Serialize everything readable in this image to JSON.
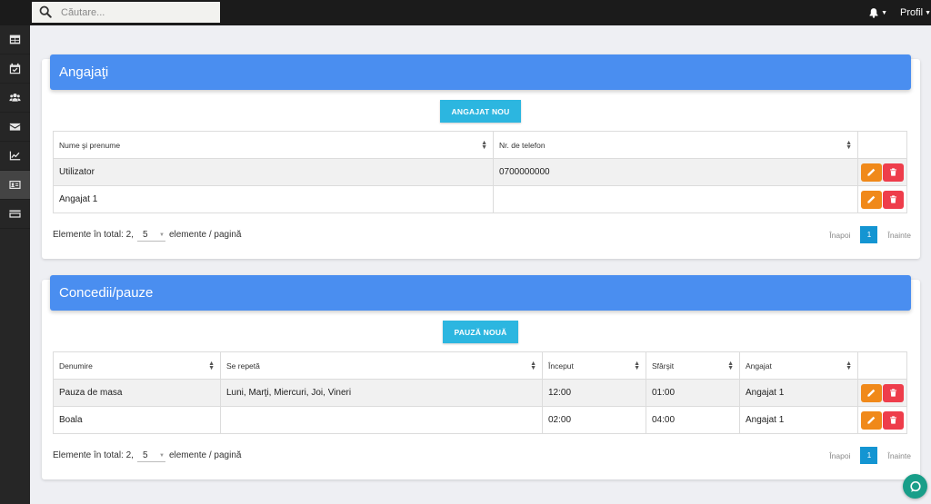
{
  "search": {
    "placeholder": "Căutare..."
  },
  "header": {
    "profile_label": "Profil"
  },
  "employees": {
    "title": "Angajaţi",
    "new_button": "Angajat nou",
    "columns": [
      "Nume şi prenume",
      "Nr. de telefon"
    ],
    "rows": [
      {
        "name": "Utilizator",
        "phone": "0700000000"
      },
      {
        "name": "Angajat 1",
        "phone": ""
      }
    ],
    "footer": {
      "total_label": "Elemente în total: 2,",
      "per_page": "5",
      "per_page_suffix": "elemente / pagină"
    },
    "pager": {
      "prev": "Înapoi",
      "page": "1",
      "next": "Înainte"
    }
  },
  "leaves": {
    "title": "Concedii/pauze",
    "new_button": "Pauză nouă",
    "columns": [
      "Denumire",
      "Se repetă",
      "Început",
      "Sfârşit",
      "Angajat"
    ],
    "rows": [
      {
        "name": "Pauza de masa",
        "repeat": "Luni, Marţi, Miercuri, Joi, Vineri",
        "start": "12:00",
        "end": "01:00",
        "employee": "Angajat 1"
      },
      {
        "name": "Boala",
        "repeat": "",
        "start": "02:00",
        "end": "04:00",
        "employee": "Angajat 1"
      }
    ],
    "footer": {
      "total_label": "Elemente în total: 2,",
      "per_page": "5",
      "per_page_suffix": "elemente / pagină"
    },
    "pager": {
      "prev": "Înapoi",
      "page": "1",
      "next": "Înainte"
    }
  },
  "icons": {
    "sidebar": [
      "table-icon",
      "calendar-check-icon",
      "users-icon",
      "envelope-icon",
      "chart-line-icon",
      "id-card-icon",
      "credit-card-icon"
    ],
    "actions": [
      "pencil-icon",
      "trash-icon"
    ]
  },
  "colors": {
    "accent": "#4a8ef0",
    "button": "#2cb6e0",
    "edit": "#f0891a",
    "delete": "#ee3d4b",
    "page_active": "#1495d2"
  }
}
